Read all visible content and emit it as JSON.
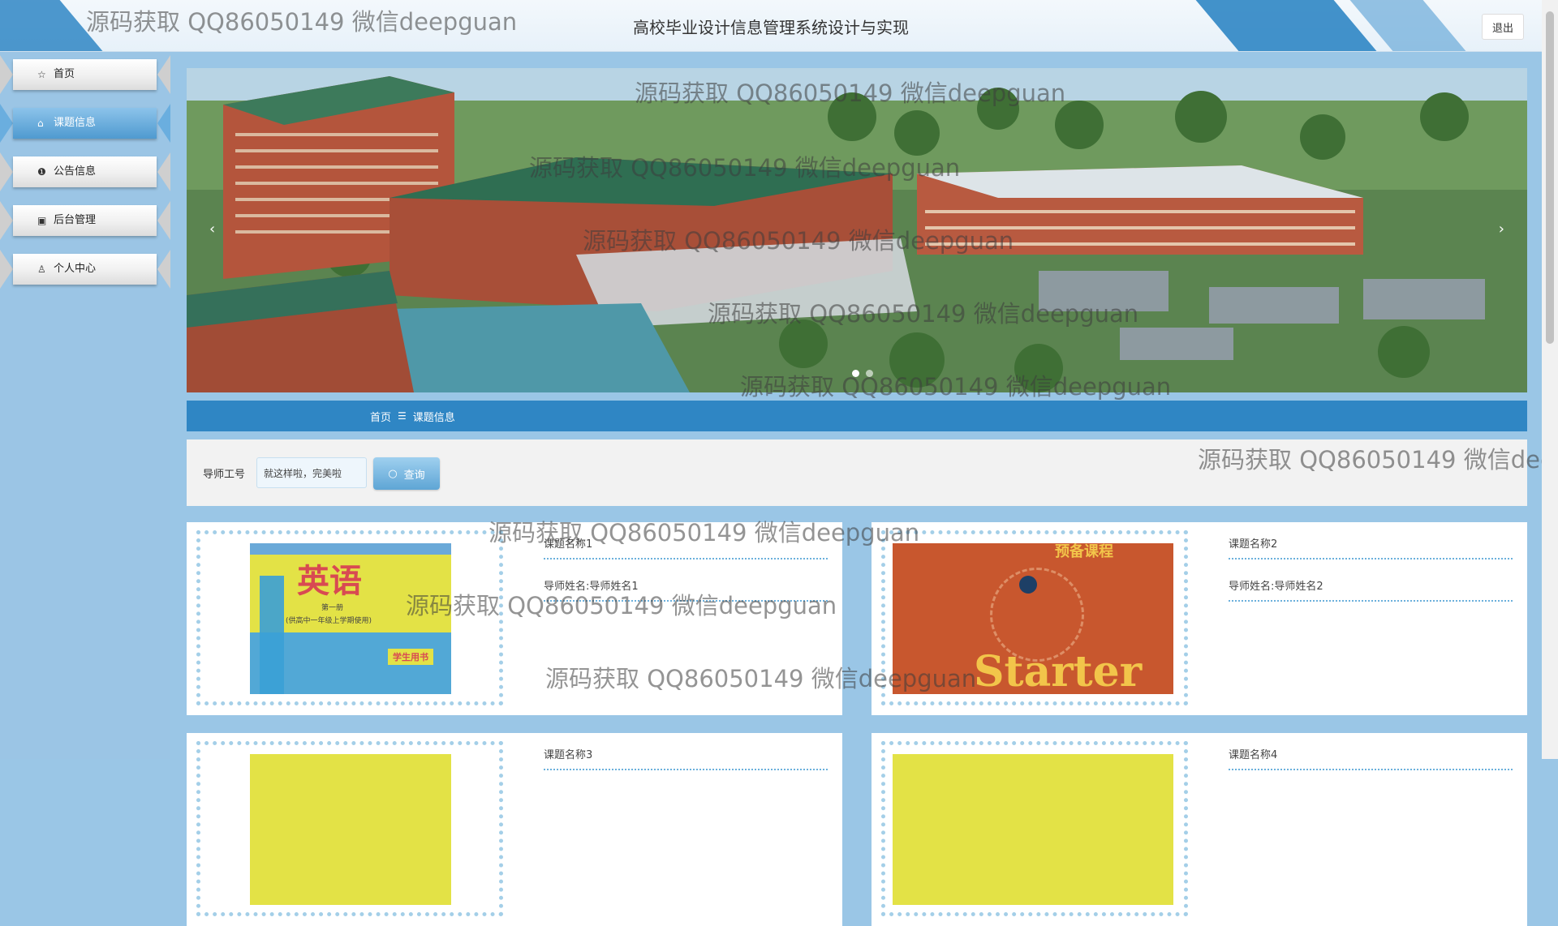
{
  "header": {
    "title": "高校毕业设计信息管理系统设计与实现",
    "logout_label": "退出"
  },
  "sidebar": {
    "items": [
      {
        "icon": "star-icon",
        "label": "首页"
      },
      {
        "icon": "bag-icon",
        "label": "课题信息",
        "active": true
      },
      {
        "icon": "alert-icon",
        "label": "公告信息"
      },
      {
        "icon": "box-icon",
        "label": "后台管理"
      },
      {
        "icon": "user-icon",
        "label": "个人中心"
      }
    ]
  },
  "banner": {
    "prev_icon": "chevron-left-icon",
    "next_icon": "chevron-right-icon",
    "prev_glyph": "‹",
    "next_glyph": "›",
    "slide_count": 2,
    "active_slide": 1
  },
  "breadcrumb": {
    "home": "首页",
    "separator": "☰",
    "current": "课题信息"
  },
  "search": {
    "label": "导师工号",
    "input_value": "就这样啦，完美啦",
    "button_label": "查询"
  },
  "topics": [
    {
      "name": "课题名称1",
      "teacher": "导师姓名:导师姓名1",
      "cover": "english-textbook-cover"
    },
    {
      "name": "课题名称2",
      "teacher": "导师姓名:导师姓名2",
      "cover": "starter-textbook-cover"
    },
    {
      "name": "课题名称3",
      "teacher": "",
      "cover": "yellow-textbook-cover"
    },
    {
      "name": "课题名称4",
      "teacher": "",
      "cover": "yellow-textbook-cover"
    }
  ],
  "covers": {
    "english_title": "英语",
    "english_edition": "第一册",
    "english_sub": "(供高中一年级上学期使用)",
    "english_badge": "学生用书",
    "starter_top": "预备课程",
    "starter_title": "Starter"
  },
  "watermark": "源码获取 QQ86050149 微信deepguan",
  "colors": {
    "accent": "#2f86c4",
    "sidebar_bg": "#9bc5e5",
    "dotted_border": "#a4cfe8"
  }
}
